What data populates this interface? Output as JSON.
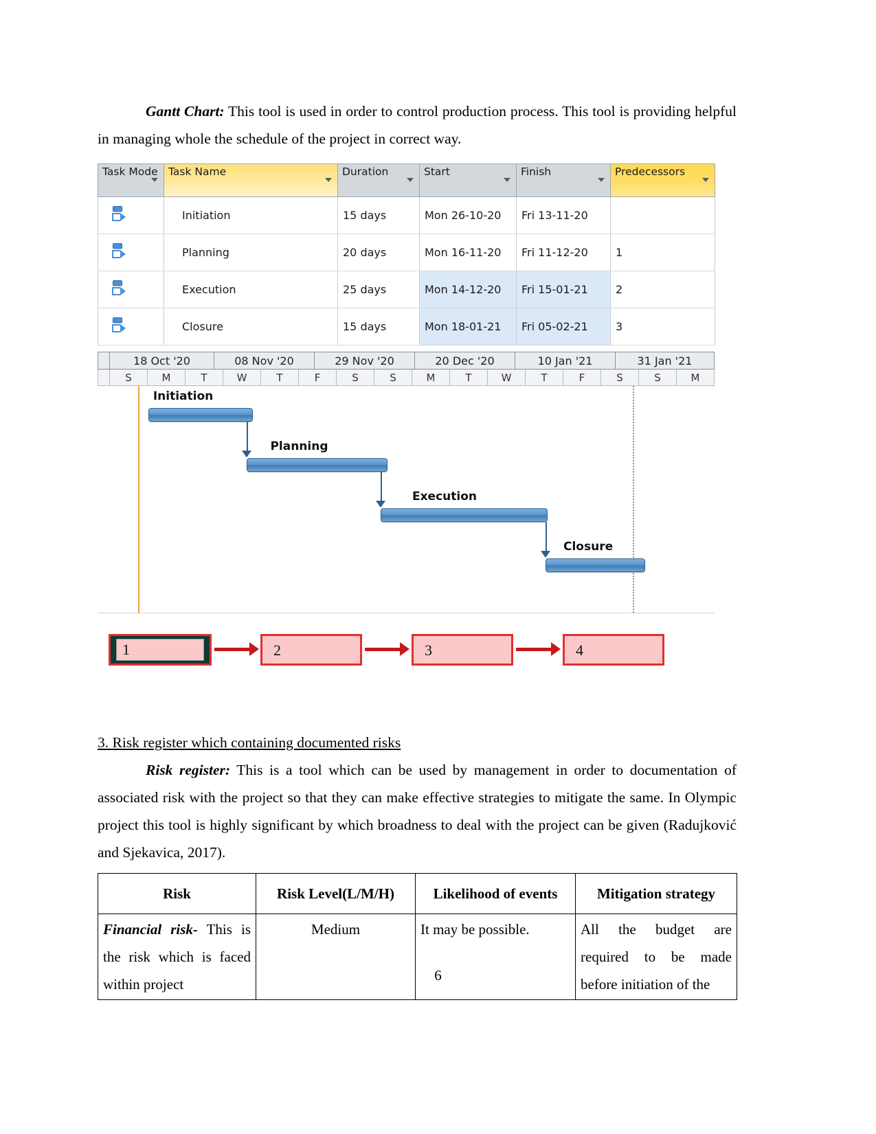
{
  "document": {
    "page_number": "6",
    "paragraphs": {
      "gantt_intro_label": "Gantt Chart:",
      "gantt_intro_text": " This tool is used in order to control production process. This tool is providing helpful in managing whole the schedule of the project in correct way.",
      "risk_heading": "3. Risk register which containing documented risks",
      "risk_intro_label": "Risk register:",
      "risk_intro_text": " This is a tool which can be used by management in order to documentation of associated risk with the project so that they can make effective strategies to mitigate the same. In Olympic project this tool is highly significant by which broadness to deal with the project can be given  (Radujković and Sjekavica, 2017)."
    }
  },
  "gantt_screenshot": {
    "grid": {
      "columns": [
        {
          "label": "Task Mode",
          "style": "grey",
          "has_caret": true
        },
        {
          "label": "Task Name",
          "style": "yellow",
          "has_caret": true
        },
        {
          "label": "Duration",
          "style": "grey",
          "has_caret": true
        },
        {
          "label": "Start",
          "style": "grey",
          "has_caret": true
        },
        {
          "label": "Finish",
          "style": "grey",
          "has_caret": true
        },
        {
          "label": "Predecessors",
          "style": "yellow-strong",
          "has_caret": true
        }
      ],
      "rows": [
        {
          "mode_icon": "auto-schedule-icon",
          "name": "Initiation",
          "duration": "15 days",
          "start": "Mon 26-10-20",
          "finish": "Fri 13-11-20",
          "predecessors": ""
        },
        {
          "mode_icon": "auto-schedule-icon",
          "name": "Planning",
          "duration": "20 days",
          "start": "Mon 16-11-20",
          "finish": "Fri 11-12-20",
          "predecessors": "1"
        },
        {
          "mode_icon": "auto-schedule-icon",
          "name": "Execution",
          "duration": "25 days",
          "start": "Mon 14-12-20",
          "finish": "Fri 15-01-21",
          "predecessors": "2"
        },
        {
          "mode_icon": "auto-schedule-icon",
          "name": "Closure",
          "duration": "15 days",
          "start": "Mon 18-01-21",
          "finish": "Fri 05-02-21",
          "predecessors": "3"
        }
      ],
      "selected_cells": [
        "row3.start",
        "row3.finish",
        "row4.start",
        "row4.finish"
      ]
    },
    "timescale": {
      "major": [
        "18 Oct '20",
        "08 Nov '20",
        "29 Nov '20",
        "20 Dec '20",
        "10 Jan '21",
        "31 Jan '21"
      ],
      "minor": [
        "S",
        "M",
        "T",
        "W",
        "T",
        "F",
        "S",
        "S",
        "M",
        "T",
        "W",
        "T",
        "F",
        "S",
        "S",
        "M"
      ]
    },
    "bars": [
      {
        "label": "Initiation",
        "left_pct": 8.2,
        "width_pct": 17.0,
        "row": 0
      },
      {
        "label": "Planning",
        "left_pct": 24.2,
        "width_pct": 22.8,
        "row": 1
      },
      {
        "label": "Execution",
        "left_pct": 45.9,
        "width_pct": 27.0,
        "row": 2
      },
      {
        "label": "Closure",
        "left_pct": 72.6,
        "width_pct": 16.1,
        "row": 3
      }
    ],
    "markers": {
      "today_line_pct": 6.6,
      "status_line_pct": 86.8
    }
  },
  "network_diagram": {
    "nodes": [
      {
        "label": "1",
        "selected": true
      },
      {
        "label": "2",
        "selected": false
      },
      {
        "label": "3",
        "selected": false
      },
      {
        "label": "4",
        "selected": false
      }
    ],
    "colors": {
      "box_fill": "#fbc9c9",
      "box_border": "#e03030",
      "arrow": "#c21a1a",
      "selection": "#0f3b33"
    }
  },
  "risk_register_table": {
    "headers": [
      "Risk",
      "Risk Level(L/M/H)",
      "Likelihood of events",
      "Mitigation strategy"
    ],
    "rows": [
      {
        "risk_label": "Financial risk-",
        "risk_text": " This is the risk which is faced  within project",
        "risk_level": "Medium",
        "likelihood": "It may be possible.",
        "mitigation": "All the budget are required to be made before initiation of the"
      }
    ]
  }
}
